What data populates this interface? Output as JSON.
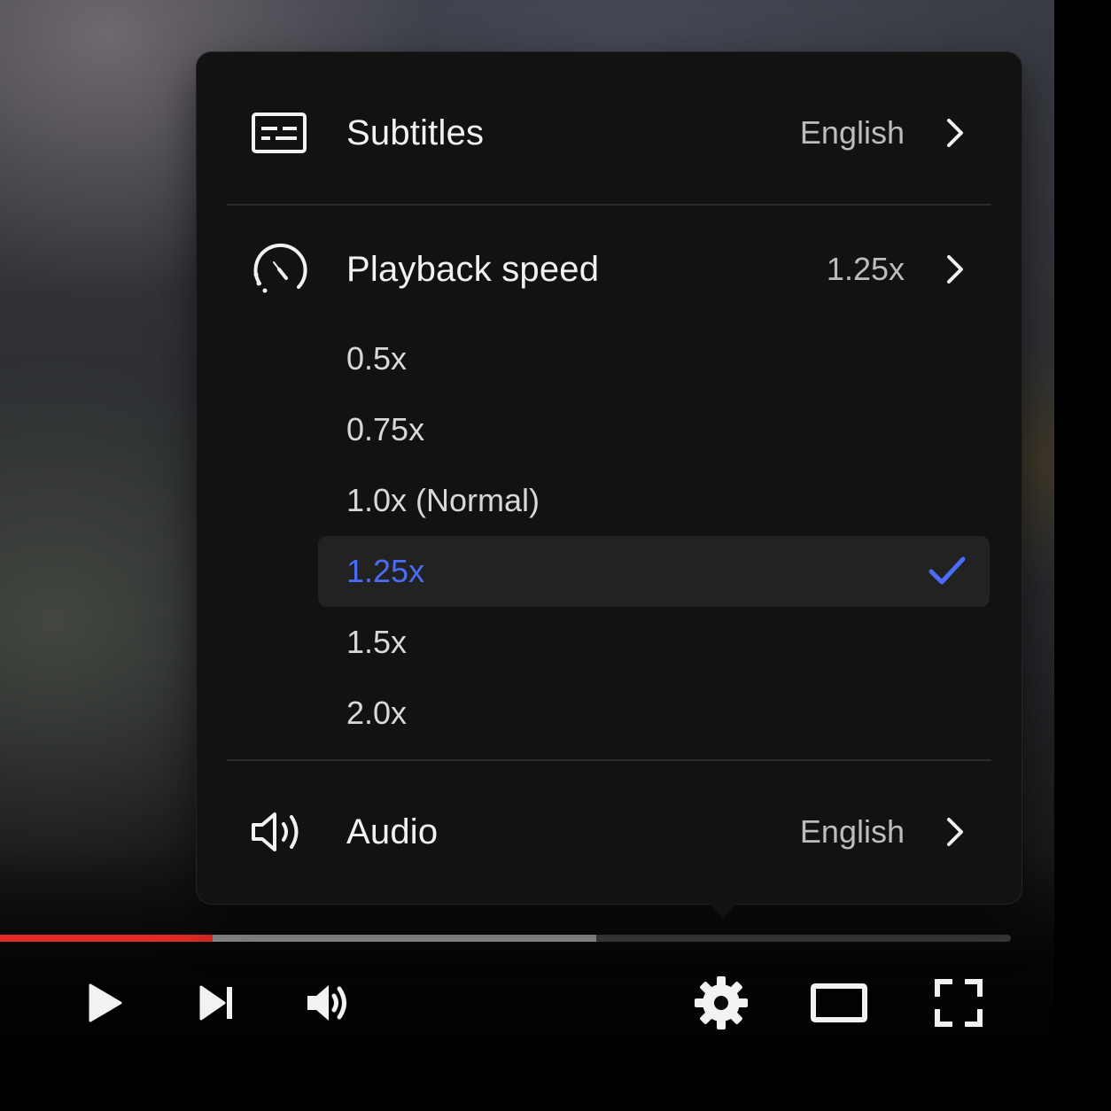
{
  "menu": {
    "subtitles": {
      "label": "Subtitles",
      "value": "English"
    },
    "playback_speed": {
      "label": "Playback speed",
      "value": "1.25x",
      "options": [
        "0.5x",
        "0.75x",
        "1.0x (Normal)",
        "1.25x",
        "1.5x",
        "2.0x"
      ],
      "selected": "1.25x"
    },
    "audio": {
      "label": "Audio",
      "value": "English"
    }
  },
  "progress": {
    "played_fraction": 0.21,
    "buffered_fraction": 0.59
  },
  "controls": [
    "play-icon",
    "skip-next-icon",
    "volume-icon",
    "gear-icon",
    "theater-mode-icon",
    "fullscreen-icon"
  ],
  "colors": {
    "accent": "#4a6cf7",
    "progress_played": "#e32b25",
    "menu_bg": "#121212",
    "selected_row_bg": "#222222"
  }
}
